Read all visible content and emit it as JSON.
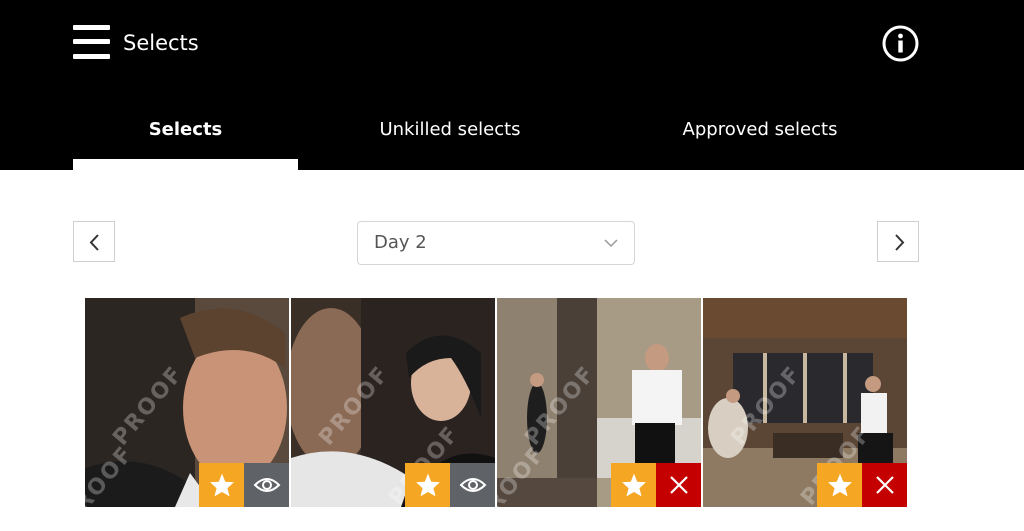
{
  "header": {
    "title": "Selects",
    "menu_icon": "hamburger-menu-icon",
    "info_icon": "info-icon"
  },
  "tabs": [
    {
      "label": "Selects",
      "active": true
    },
    {
      "label": "Unkilled selects",
      "active": false
    },
    {
      "label": "Approved selects",
      "active": false
    }
  ],
  "day_selector": {
    "value": "Day 2",
    "prev_icon": "chevron-left-icon",
    "next_icon": "chevron-right-icon"
  },
  "watermark_text": "PROOF",
  "photos": [
    {
      "subject": "groom close-up portrait",
      "actions": [
        "star",
        "view"
      ]
    },
    {
      "subject": "bride profile portrait",
      "actions": [
        "star",
        "view"
      ]
    },
    {
      "subject": "man leaning on bed, woman in doorway",
      "actions": [
        "star",
        "reject"
      ]
    },
    {
      "subject": "couple seated in room with windows",
      "actions": [
        "star",
        "reject"
      ]
    }
  ],
  "colors": {
    "header_bg": "#000000",
    "star_bg": "#f5a623",
    "view_bg": "#5f6368",
    "reject_bg": "#c40000"
  }
}
